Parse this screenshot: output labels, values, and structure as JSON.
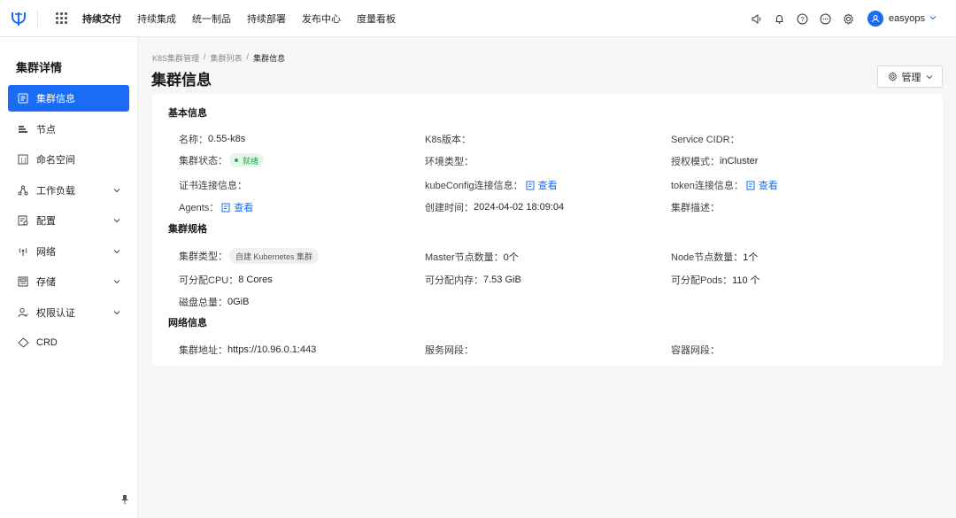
{
  "topnav": {
    "items": [
      "持续交付",
      "持续集成",
      "统一制品",
      "持续部署",
      "发布中心",
      "度量看板"
    ],
    "user": "easyops"
  },
  "sidebar": {
    "title": "集群详情",
    "items": [
      {
        "label": "集群信息",
        "icon": "cluster-info-icon"
      },
      {
        "label": "节点",
        "icon": "node-icon"
      },
      {
        "label": "命名空间",
        "icon": "namespace-icon"
      },
      {
        "label": "工作负载",
        "icon": "workload-icon"
      },
      {
        "label": "配置",
        "icon": "config-icon"
      },
      {
        "label": "网络",
        "icon": "network-icon"
      },
      {
        "label": "存储",
        "icon": "storage-icon"
      },
      {
        "label": "权限认证",
        "icon": "auth-icon"
      },
      {
        "label": "CRD",
        "icon": "crd-icon"
      }
    ]
  },
  "breadcrumb": {
    "items": [
      "K8S集群管理",
      "集群列表",
      "集群信息"
    ],
    "sep": "/"
  },
  "page": {
    "title": "集群信息",
    "manage_label": "管理"
  },
  "sections": {
    "basic": "基本信息",
    "spec": "集群规格",
    "network": "网络信息"
  },
  "basic": {
    "name_label": "名称：",
    "name_value": "0.55-k8s",
    "k8s_version_label": "K8s版本：",
    "service_cidr_label": "Service CIDR：",
    "status_label": "集群状态：",
    "status_value": "就绪",
    "env_type_label": "环境类型：",
    "auth_mode_label": "授权模式：",
    "auth_mode_value": "inCluster",
    "cert_label": "证书连接信息：",
    "kubeconfig_label": "kubeConfig连接信息：",
    "kubeconfig_link": "查看",
    "token_label": "token连接信息：",
    "token_link": "查看",
    "agents_label": "Agents：",
    "agents_link": "查看",
    "created_label": "创建时间：",
    "created_value": "2024-04-02 18:09:04",
    "desc_label": "集群描述："
  },
  "spec": {
    "type_label": "集群类型：",
    "type_value": "自建 Kubernetes 集群",
    "master_label": "Master节点数量：",
    "master_value": "0个",
    "node_label": "Node节点数量：",
    "node_value": "1个",
    "cpu_label": "可分配CPU：",
    "cpu_value": "8 Cores",
    "mem_label": "可分配内存：",
    "mem_value": "7.53 GiB",
    "pods_label": "可分配Pods：",
    "pods_value": "110 个",
    "disk_label": "磁盘总量：",
    "disk_value": "0GiB"
  },
  "network": {
    "addr_label": "集群地址：",
    "addr_value": "https://10.96.0.1:443",
    "svc_label": "服务网段：",
    "pod_label": "容器网段："
  },
  "colors": {
    "accent": "#1a6cf5",
    "success": "#2ba24c"
  }
}
